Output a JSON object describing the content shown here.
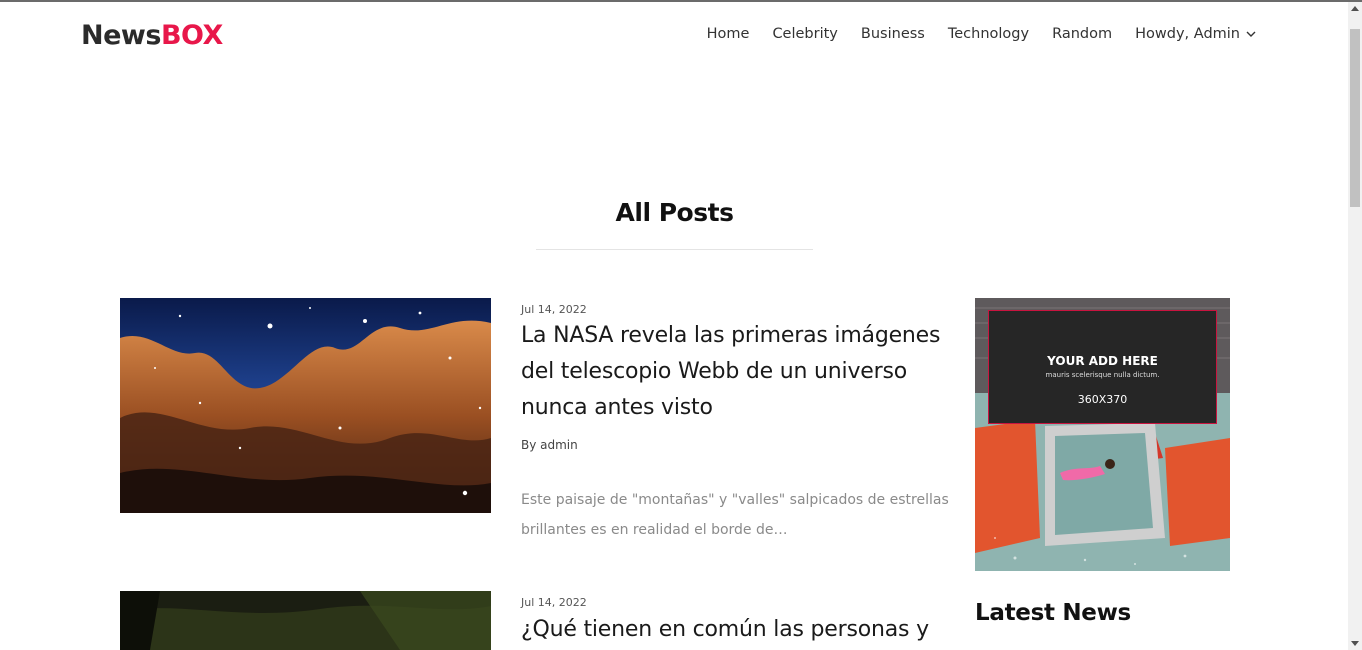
{
  "brand": {
    "part1": "News",
    "part2": "BOX",
    "accent": "#e8174a"
  },
  "nav": {
    "items": [
      "Home",
      "Celebrity",
      "Business",
      "Technology",
      "Random"
    ],
    "user_menu": "Howdy, Admin"
  },
  "page": {
    "title": "All Posts"
  },
  "posts": [
    {
      "date": "Jul 14, 2022",
      "title": "La NASA revela las primeras imágenes del telescopio Webb de un universo nunca antes visto",
      "author": "By admin",
      "excerpt": "Este paisaje de \"montañas\" y \"valles\" salpicados de estrellas brillantes es en realidad el borde de…"
    },
    {
      "date": "Jul 14, 2022",
      "title": "¿Qué tienen en común las personas y"
    }
  ],
  "ad": {
    "title": "YOUR ADD HERE",
    "subtitle": "mauris scelerisque nulla dictum.",
    "size": "360X370"
  },
  "sidebar": {
    "latest_heading": "Latest News"
  }
}
